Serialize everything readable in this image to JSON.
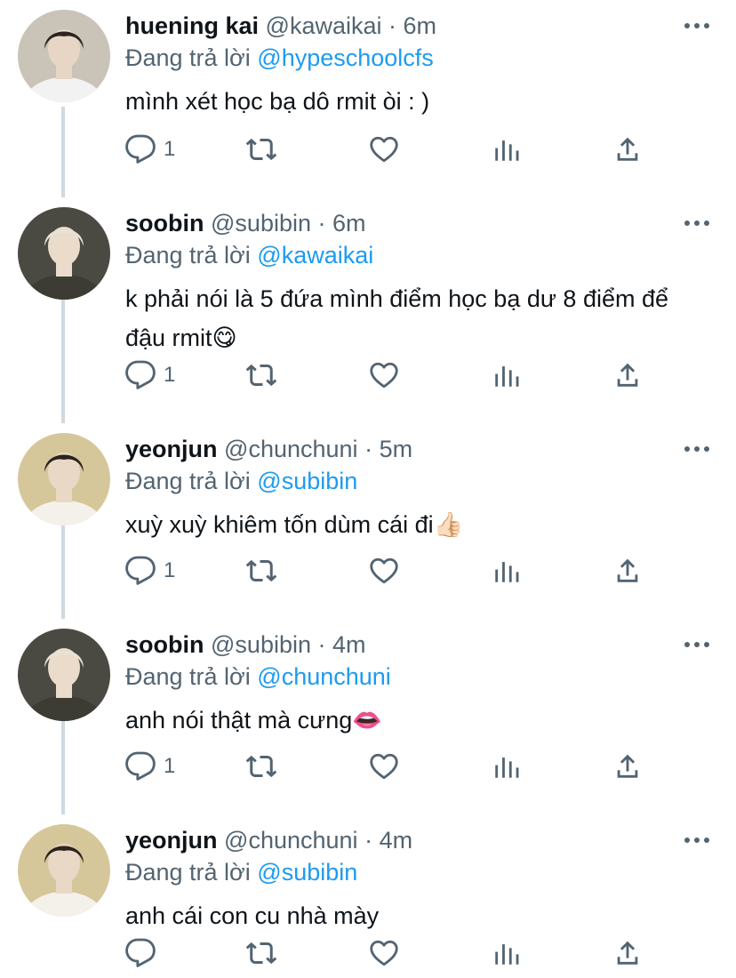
{
  "reply_prefix": "Đang trả lời",
  "colors": {
    "mention": "#1d9bf0",
    "secondary": "#536471",
    "thread_line": "#cfd9de"
  },
  "tweets": [
    {
      "name": "huening kai",
      "handle": "@kawaikai",
      "dot": "·",
      "time": "6m",
      "reply_to": "@hypeschoolcfs",
      "text": "mình xét học bạ dô rmit òi : )",
      "emoji": "",
      "reply_count": "1",
      "avatar": "avatar-photo"
    },
    {
      "name": "soobin",
      "handle": "@subibin",
      "dot": "·",
      "time": "6m",
      "reply_to": "@kawaikai",
      "text": "k phải nói là 5 đứa mình điểm học bạ dư 8 điểm để đậu rmit",
      "emoji": "😋",
      "reply_count": "1",
      "avatar": "avatar-photo"
    },
    {
      "name": "yeonjun",
      "handle": "@chunchuni",
      "dot": "·",
      "time": "5m",
      "reply_to": "@subibin",
      "text": "xuỳ xuỳ khiêm tốn dùm cái đi",
      "emoji": "👍🏻",
      "reply_count": "1",
      "avatar": "avatar-photo"
    },
    {
      "name": "soobin",
      "handle": "@subibin",
      "dot": "·",
      "time": "4m",
      "reply_to": "@chunchuni",
      "text": "anh nói thật mà cưng",
      "emoji": "👄",
      "reply_count": "1",
      "avatar": "avatar-photo"
    },
    {
      "name": "yeonjun",
      "handle": "@chunchuni",
      "dot": "·",
      "time": "4m",
      "reply_to": "@subibin",
      "text": "anh cái con cu nhà mày",
      "emoji": "",
      "reply_count": "",
      "avatar": "avatar-photo"
    }
  ]
}
